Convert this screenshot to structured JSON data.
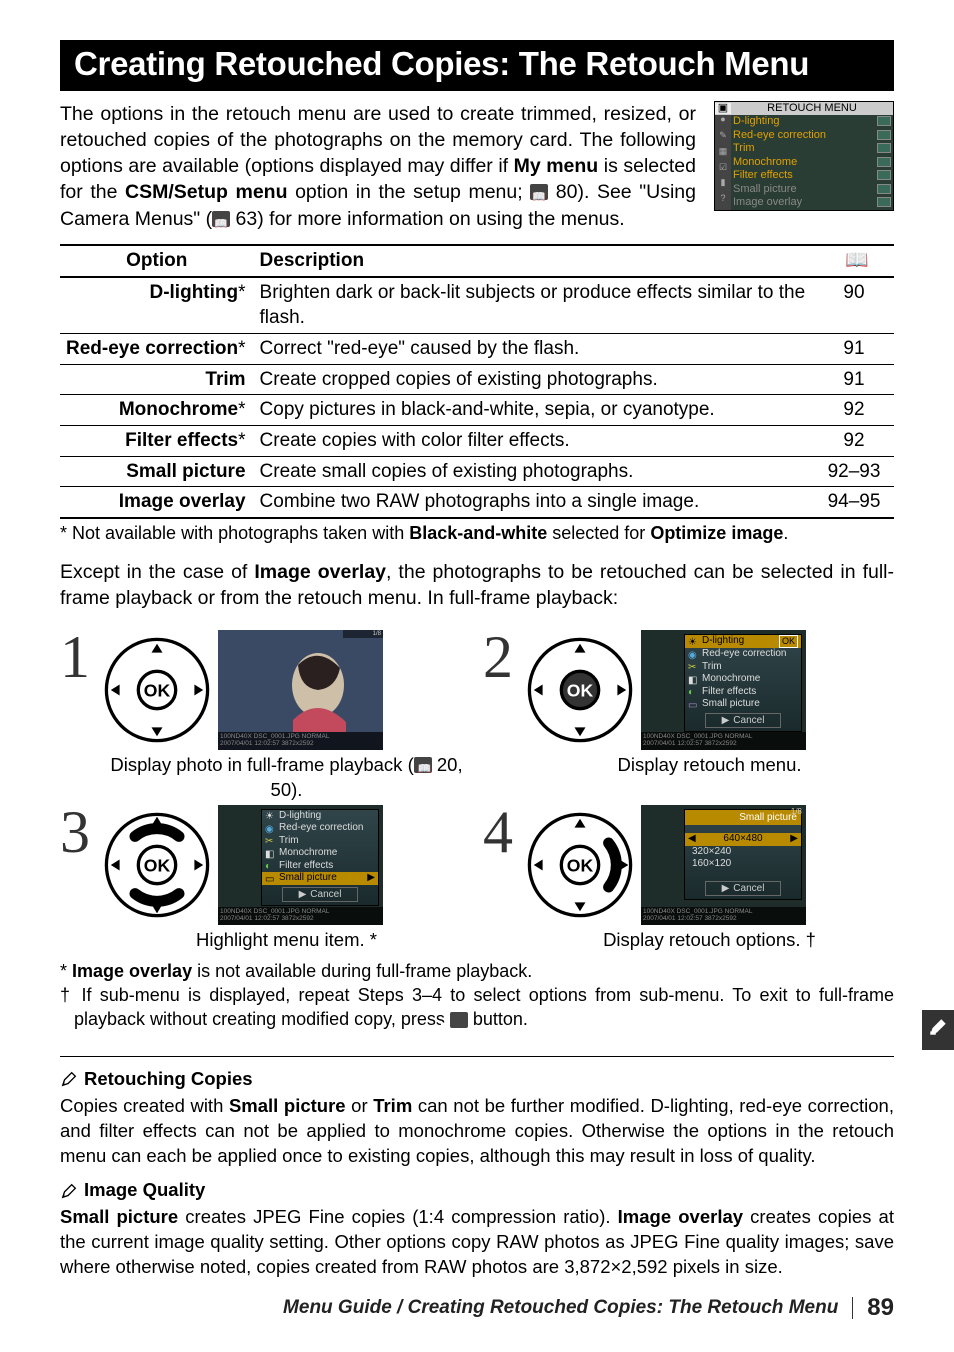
{
  "h1": "Creating Retouched Copies: The Retouch Menu",
  "intro_a": "The options in the retouch menu are used to create trimmed, resized, or retouched copies of the photographs on the memory card.  The following options are available (options displayed may differ if ",
  "intro_b": " is selected for the ",
  "intro_c": " option in the setup menu; ",
  "intro_d": " 80).  See \"Using Camera Menus\" (",
  "intro_e": " 63) for more information on using the menus.",
  "intro_bold1": "My menu",
  "intro_bold2": "CSM/Setup menu",
  "menu_title": "RETOUCH MENU",
  "menu_items": [
    "D-lighting",
    "Red-eye correction",
    "Trim",
    "Monochrome",
    "Filter effects",
    "Small picture",
    "Image overlay"
  ],
  "th_option": "Option",
  "th_desc": "Description",
  "rows": [
    {
      "opt": "D-lighting",
      "ast": "*",
      "desc": "Brighten dark or back-lit subjects or produce effects similar to the flash.",
      "pg": "90"
    },
    {
      "opt": "Red-eye correction",
      "ast": "*",
      "desc": "Correct \"red-eye\" caused by the flash.",
      "pg": "91"
    },
    {
      "opt": "Trim",
      "ast": "",
      "desc": "Create cropped copies of existing photographs.",
      "pg": "91"
    },
    {
      "opt": "Monochrome",
      "ast": "*",
      "desc": "Copy pictures in black-and-white, sepia, or cyanotype.",
      "pg": "92"
    },
    {
      "opt": "Filter effects",
      "ast": "*",
      "desc": "Create copies with color filter effects.",
      "pg": "92"
    },
    {
      "opt": "Small picture",
      "ast": "",
      "desc": "Create small copies of existing photographs.",
      "pg": "92–93"
    },
    {
      "opt": "Image overlay",
      "ast": "",
      "desc": "Combine two RAW photographs into a single image.",
      "pg": "94–95"
    }
  ],
  "tbl_foot_a": "* Not available with photographs taken with ",
  "tbl_foot_b": "Black-and-white",
  "tbl_foot_c": " selected for ",
  "tbl_foot_d": "Optimize image",
  "tbl_foot_e": ".",
  "para2_a": "Except in the case of ",
  "para2_b": "Image overlay",
  "para2_c": ", the photographs to be retouched can be selected in full-frame playback or from the retouch menu.  In full-frame playback:",
  "steps": {
    "s1": "1",
    "s2": "2",
    "s3": "3",
    "s4": "4",
    "c1_a": "Display photo in full-frame playback (",
    "c1_b": " 20, 50).",
    "c2": "Display retouch menu.",
    "c3": "Highlight menu item. *",
    "c4": "Display retouch options. †",
    "thumb_bar_l1": "100ND40X   DSC_0001.JPG        NORMAL",
    "thumb_bar_l2": "2007/04/01 12:02:57           3872x2592",
    "thumb_top": "1/8",
    "popup_items": [
      "D-lighting",
      "Red-eye correction",
      "Trim",
      "Monochrome",
      "Filter effects",
      "Small picture"
    ],
    "popup_cancel": "Cancel",
    "popup_small_title": "Small picture",
    "popup_sizes": [
      "640×480",
      "320×240",
      "160×120"
    ],
    "ok": "OK"
  },
  "note1_a": "* ",
  "note1_b": "Image overlay",
  "note1_c": " is not available during full-frame playback.",
  "note2": "† If sub-menu is displayed, repeat Steps 3–4 to select options from sub-menu.  To exit to full-frame playback without creating modified copy, press ",
  "note2_b": " button.",
  "sec1_h": "Retouching Copies",
  "sec1_a": "Copies created with ",
  "sec1_b1": "Small picture",
  "sec1_c": " or ",
  "sec1_b2": "Trim",
  "sec1_d": " can not be further modified.  D-lighting, red-eye correction, and filter effects can not be applied to monochrome copies.  Otherwise the options in the retouch menu can each be applied once to existing copies, although this may result in loss of quality.",
  "sec2_h": "Image Quality",
  "sec2_a": "Small picture",
  "sec2_b": " creates JPEG Fine copies (1:4 compression ratio).  ",
  "sec2_c": "Image overlay",
  "sec2_d": " creates copies at the current image quality setting.  Other options copy RAW photos as JPEG Fine quality images; save where otherwise noted, copies created from RAW photos are 3,872×2,592 pixels in size.",
  "footer_a": "Menu Guide / Creating Retouched Copies: The Retouch Menu",
  "page_no": "89",
  "side_tab": "🖌"
}
